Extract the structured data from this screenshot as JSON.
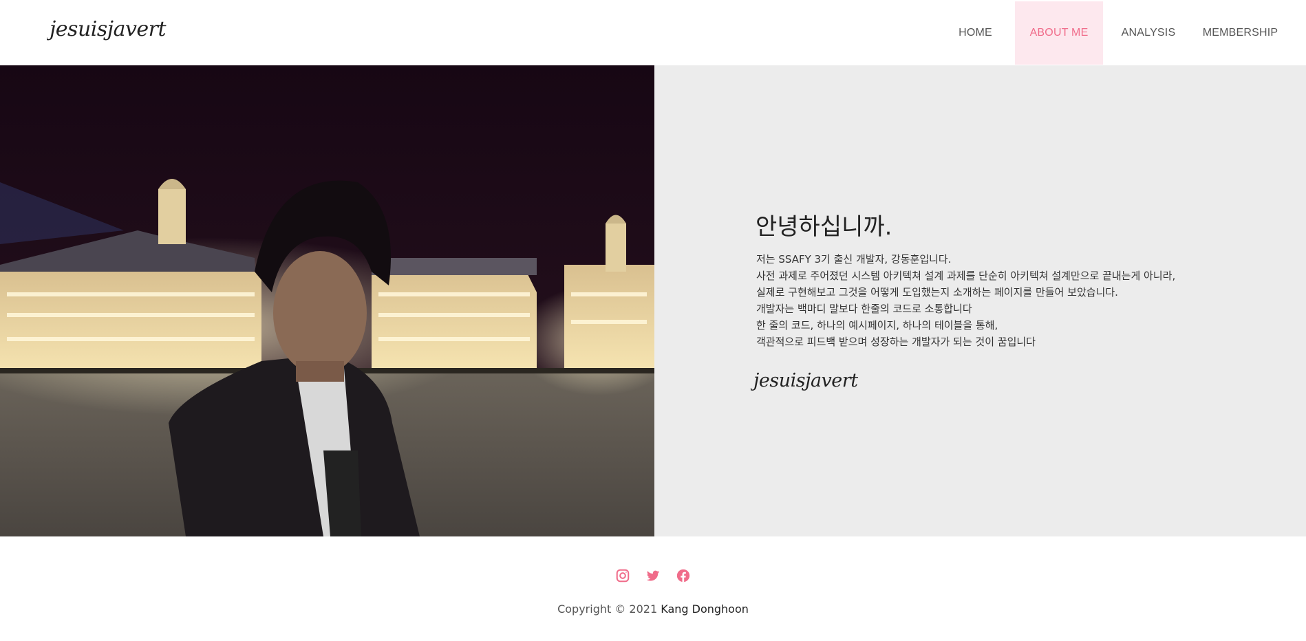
{
  "header": {
    "logo_text": "jesuisjavert",
    "nav": [
      {
        "label": "HOME"
      },
      {
        "label": "ABOUT ME",
        "active": true
      },
      {
        "label": "ANALYSIS"
      },
      {
        "label": "MEMBERSHIP"
      }
    ]
  },
  "intro": {
    "title": "안녕하십니까.",
    "lines": [
      "저는 SSAFY 3기 출신 개발자, 강동훈입니다.",
      "사전 과제로 주어졌던 시스템 아키텍쳐 설계 과제를 단순히 아키텍쳐 설계만으로 끝내는게 아니라,",
      "실제로 구현해보고 그것을 어떻게 도입했는지 소개하는 페이지를 만들어 보았습니다.",
      "개발자는 백마디 말보다 한줄의 코드로 소통합니다",
      "한 줄의 코드, 하나의 예시페이지, 하나의 테이블을 통해,",
      "객관적으로 피드백 받으며 성장하는 개발자가 되는 것이 꿈입니다"
    ],
    "signature_text": "jesuisjavert"
  },
  "footer": {
    "social_icons": [
      "instagram-icon",
      "twitter-icon",
      "facebook-icon"
    ],
    "copyright_prefix": "Copyright © 2021 ",
    "copyright_name": "Kang Donghoon"
  },
  "colors": {
    "accent": "#f06c8a",
    "active_nav_bg": "#fde8ee",
    "intro_bg": "#ececec"
  }
}
